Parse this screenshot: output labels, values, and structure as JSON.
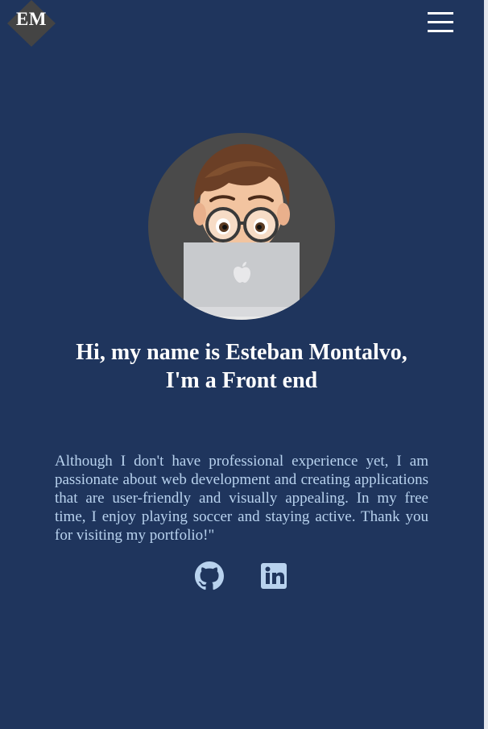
{
  "logo": {
    "text": "EM",
    "bg_color": "#444444"
  },
  "menu": {
    "icon": "hamburger-menu-icon"
  },
  "hero": {
    "avatar_icon": "memoji-avatar-with-laptop",
    "headline_line1": "Hi, my name is Esteban Montalvo,",
    "headline_line2": "I'm a Front end"
  },
  "bio": {
    "text": "Although I don't have professional experience yet, I am passionate about web development and creating applications that are user-friendly and visually appealing. In my free time, I enjoy playing soccer and staying active. Thank you for visiting my portfolio!\""
  },
  "socials": [
    {
      "name": "GitHub",
      "icon": "github-icon"
    },
    {
      "name": "LinkedIn",
      "icon": "linkedin-icon"
    }
  ],
  "colors": {
    "background": "#1f355d",
    "text_light": "#b8d2ee",
    "heading": "#ffffff"
  }
}
